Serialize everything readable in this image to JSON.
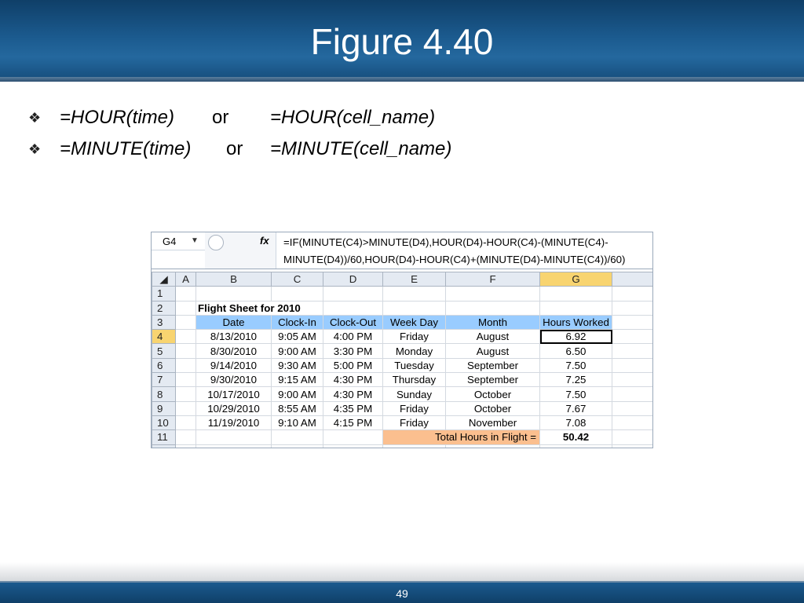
{
  "slide": {
    "title": "Figure 4.40",
    "page_number": "49"
  },
  "bullets": [
    {
      "formula1": "=HOUR(time)",
      "or": "or",
      "formula2": "=HOUR(cell_name)"
    },
    {
      "formula1": "=MINUTE(time)",
      "or": "or",
      "formula2": "=MINUTE(cell_name)"
    }
  ],
  "sheet": {
    "name_box": "G4",
    "fx_label": "fx",
    "formula_text": "=IF(MINUTE(C4)>MINUTE(D4),HOUR(D4)-HOUR(C4)-(MINUTE(C4)-MINUTE(D4))/60,HOUR(D4)-HOUR(C4)+(MINUTE(D4)-MINUTE(C4))/60)",
    "columns": [
      "A",
      "B",
      "C",
      "D",
      "E",
      "F",
      "G"
    ],
    "rows": [
      "1",
      "2",
      "3",
      "4",
      "5",
      "6",
      "7",
      "8",
      "9",
      "10",
      "11"
    ],
    "sheet_title": "Flight Sheet for 2010",
    "headers": [
      "Date",
      "Clock-In",
      "Clock-Out",
      "Week Day",
      "Month",
      "Hours Worked"
    ],
    "data": [
      [
        "8/13/2010",
        "9:05 AM",
        "4:00 PM",
        "Friday",
        "August",
        "6.92"
      ],
      [
        "8/30/2010",
        "9:00 AM",
        "3:30 PM",
        "Monday",
        "August",
        "6.50"
      ],
      [
        "9/14/2010",
        "9:30 AM",
        "5:00 PM",
        "Tuesday",
        "September",
        "7.50"
      ],
      [
        "9/30/2010",
        "9:15 AM",
        "4:30 PM",
        "Thursday",
        "September",
        "7.25"
      ],
      [
        "10/17/2010",
        "9:00 AM",
        "4:30 PM",
        "Sunday",
        "October",
        "7.50"
      ],
      [
        "10/29/2010",
        "8:55 AM",
        "4:35 PM",
        "Friday",
        "October",
        "7.67"
      ],
      [
        "11/19/2010",
        "9:10 AM",
        "4:15 PM",
        "Friday",
        "November",
        "7.08"
      ]
    ],
    "total_label": "Total Hours in Flight =",
    "total_value": "50.42",
    "colors": {
      "header_fill": "#99ccff",
      "total_fill": "#fbbf8f",
      "selected_header": "#f8d470"
    }
  }
}
